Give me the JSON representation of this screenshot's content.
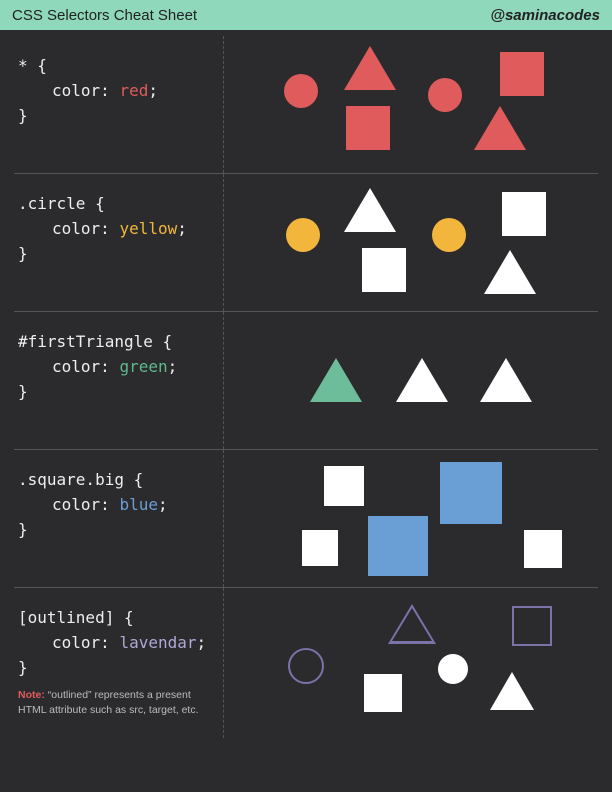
{
  "header": {
    "title": "CSS Selectors Cheat Sheet",
    "handle": "@saminacodes"
  },
  "rows": [
    {
      "selector": "* {",
      "prop": "color",
      "value": "red",
      "valueClass": "val-red"
    },
    {
      "selector": ".circle {",
      "prop": "color",
      "value": "yellow",
      "valueClass": "val-yellow"
    },
    {
      "selector": "#firstTriangle {",
      "prop": "color",
      "value": "green",
      "valueClass": "val-green"
    },
    {
      "selector": ".square.big {",
      "prop": "color",
      "value": "blue",
      "valueClass": "val-blue"
    },
    {
      "selector": "[outlined] {",
      "prop": "color",
      "value": "lavendar",
      "valueClass": "val-lav"
    }
  ],
  "note": {
    "label": "Note:",
    "text": "“outlined” represents a present HTML attribute such as src, target, etc."
  },
  "close": "}"
}
